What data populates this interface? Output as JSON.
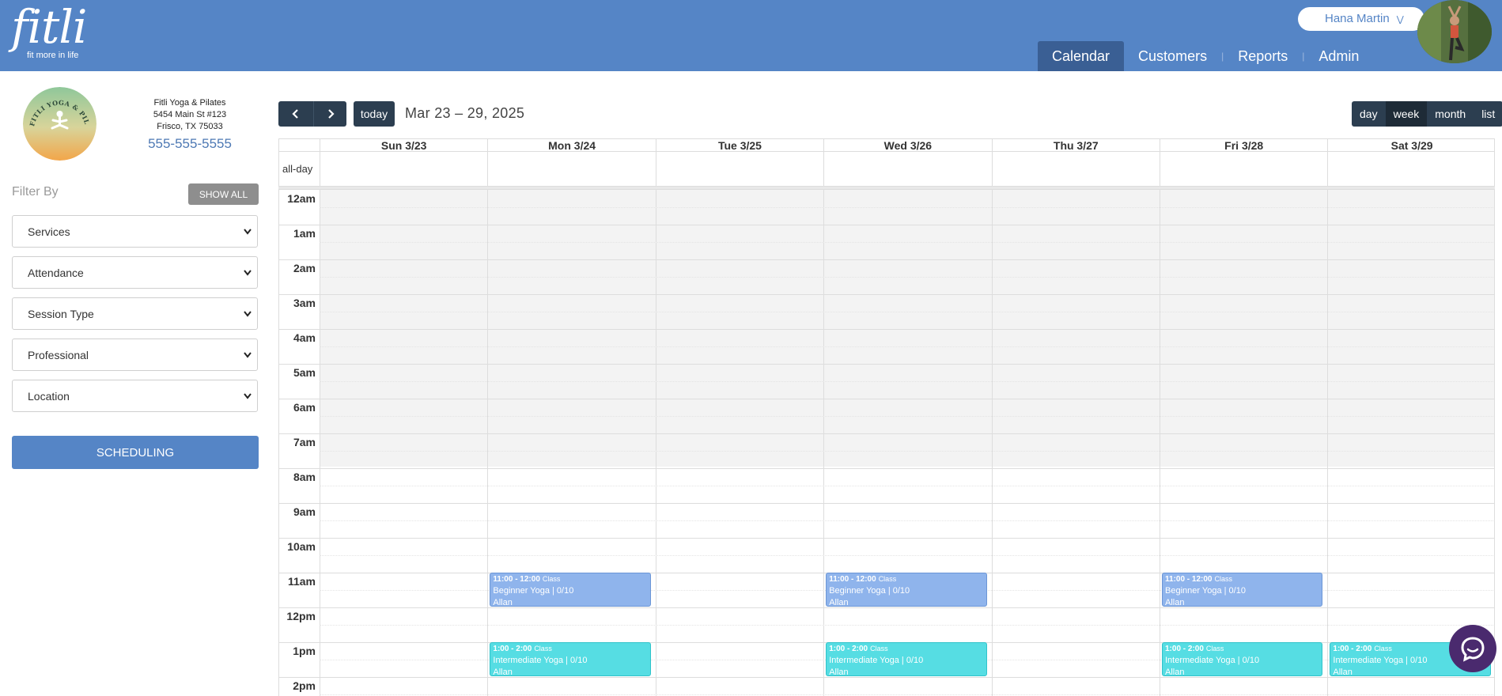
{
  "header": {
    "logo": {
      "word": "fitli",
      "tagline": "fit more in life"
    },
    "user": {
      "name": "Hana Martin"
    },
    "nav": [
      {
        "label": "Calendar",
        "active": true
      },
      {
        "label": "Customers",
        "active": false
      },
      {
        "label": "Reports",
        "active": false
      },
      {
        "label": "Admin",
        "active": false
      }
    ],
    "colors": {
      "brand": "#5585c6",
      "nav_active": "#3a5f94"
    }
  },
  "sidebar": {
    "business": {
      "logo_text": "FITLI YOGA & PILATES",
      "name": "Fitli Yoga & Pilates",
      "address_line1": "5454 Main St #123",
      "address_line2": "Frisco, TX 75033",
      "phone": "555-555-5555"
    },
    "filter_label": "Filter By",
    "show_all_label": "SHOW ALL",
    "filters": [
      "Services",
      "Attendance",
      "Session Type",
      "Professional",
      "Location"
    ],
    "scheduling_label": "SCHEDULING"
  },
  "toolbar": {
    "today_label": "today",
    "date_range": "Mar 23 – 29, 2025",
    "views": [
      {
        "label": "day",
        "active": false
      },
      {
        "label": "week",
        "active": true
      },
      {
        "label": "month",
        "active": false
      },
      {
        "label": "list",
        "active": false
      }
    ]
  },
  "calendar": {
    "days": [
      "Sun 3/23",
      "Mon 3/24",
      "Tue 3/25",
      "Wed 3/26",
      "Thu 3/27",
      "Fri 3/28",
      "Sat 3/29"
    ],
    "allday_label": "all-day",
    "hours": [
      "12am",
      "1am",
      "2am",
      "3am",
      "4am",
      "5am",
      "6am",
      "7am",
      "8am",
      "9am",
      "10am",
      "11am",
      "12pm",
      "1pm",
      "2pm"
    ],
    "events": [
      {
        "day": 1,
        "start": 11,
        "time": "11:00 - 12:00",
        "type": "Class",
        "title": "Beginner Yoga | 0/10",
        "instructor": "Allan",
        "color": "blue"
      },
      {
        "day": 3,
        "start": 11,
        "time": "11:00 - 12:00",
        "type": "Class",
        "title": "Beginner Yoga | 0/10",
        "instructor": "Allan",
        "color": "blue"
      },
      {
        "day": 5,
        "start": 11,
        "time": "11:00 - 12:00",
        "type": "Class",
        "title": "Beginner Yoga | 0/10",
        "instructor": "Allan",
        "color": "blue"
      },
      {
        "day": 1,
        "start": 13,
        "time": "1:00 - 2:00",
        "type": "Class",
        "title": "Intermediate Yoga | 0/10",
        "instructor": "Allan",
        "color": "teal"
      },
      {
        "day": 3,
        "start": 13,
        "time": "1:00 - 2:00",
        "type": "Class",
        "title": "Intermediate Yoga | 0/10",
        "instructor": "Allan",
        "color": "teal"
      },
      {
        "day": 5,
        "start": 13,
        "time": "1:00 - 2:00",
        "type": "Class",
        "title": "Intermediate Yoga | 0/10",
        "instructor": "Allan",
        "color": "teal"
      },
      {
        "day": 6,
        "start": 13,
        "time": "1:00 - 2:00",
        "type": "Class",
        "title": "Intermediate Yoga | 0/10",
        "instructor": "Allan",
        "color": "teal"
      }
    ],
    "colors": {
      "class_blue": "#8fb4ec",
      "class_teal": "#56dde3"
    }
  },
  "chat": {
    "icon": "chat-bubble-icon"
  }
}
